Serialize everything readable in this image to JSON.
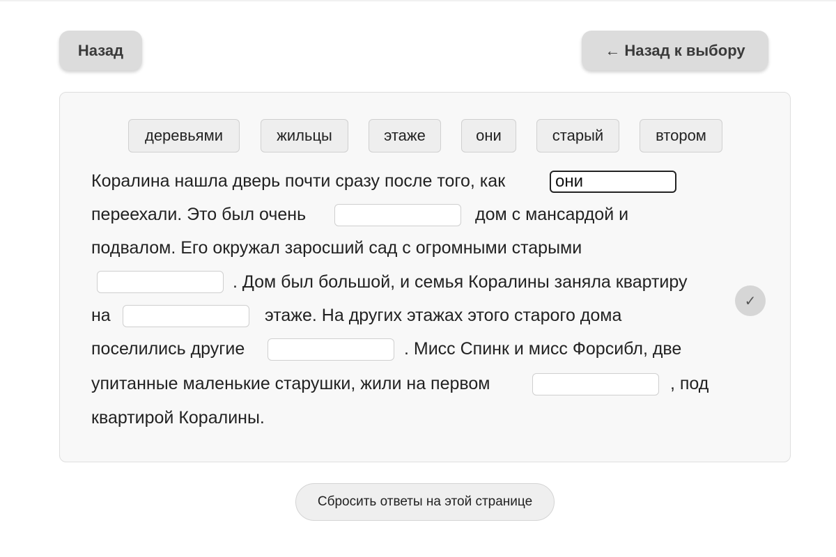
{
  "header": {
    "back_label": "Назад",
    "back_to_choice_arrow": "←",
    "back_to_choice_label": "Назад к выбору"
  },
  "word_bank": [
    "деревьями",
    "жильцы",
    "этаже",
    "они",
    "старый",
    "втором"
  ],
  "passage": {
    "line1_a": "Коралина нашла дверь почти сразу после того, как",
    "blank1_value": "они",
    "line2_a": "переехали. Это был очень",
    "blank2_value": "",
    "line2_b": "дом с мансардой и",
    "line3": "подвалом. Его окружал заросший сад с огромными старыми",
    "blank3_value": "",
    "line4_b": ". Дом был большой, и семья Коралины заняла квартиру",
    "line5_a": "на",
    "blank4_value": "",
    "line5_b": "этаже. На других этажах этого старого дома",
    "line6_a": "поселились другие",
    "blank5_value": "",
    "line6_b": ". Мисс Спинк и мисс Форсибл, две",
    "line7_a": "упитанные маленькие старушки, жили на первом",
    "blank6_value": "",
    "line7_b": ", под",
    "line8": "квартирой Коралины."
  },
  "check_icon": "check-icon",
  "check_glyph": "✓",
  "reset_label": "Сбросить ответы на этой странице"
}
